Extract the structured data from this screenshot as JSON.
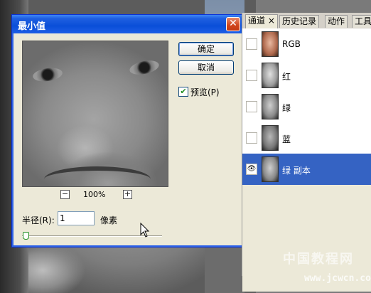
{
  "dialog": {
    "title": "最小值",
    "close_label": "✕",
    "ok_label": "确定",
    "cancel_label": "取消",
    "preview_label": "预览(P)",
    "preview_checked": true,
    "zoom_out_label": "−",
    "zoom_in_label": "+",
    "zoom_level": "100%",
    "radius_label": "半径(R):",
    "radius_value": "1",
    "unit_label": "像素"
  },
  "panel": {
    "tabs": [
      {
        "label": "通道 ×"
      },
      {
        "label": "历史记录"
      },
      {
        "label": "动作"
      },
      {
        "label": "工具"
      }
    ],
    "channels": [
      {
        "name": "RGB",
        "visible": false,
        "selected": false
      },
      {
        "name": "红",
        "visible": false,
        "selected": false
      },
      {
        "name": "绿",
        "visible": false,
        "selected": false
      },
      {
        "name": "蓝",
        "visible": false,
        "selected": false
      },
      {
        "name": "绿 副本",
        "visible": true,
        "selected": true
      }
    ]
  },
  "watermark": {
    "text": "中国教程网",
    "url": "www.jcwcn.com"
  },
  "colors": {
    "titlebar": "#0a4fd8",
    "selection": "#3563c3",
    "dialog_bg": "#ece9d8"
  }
}
